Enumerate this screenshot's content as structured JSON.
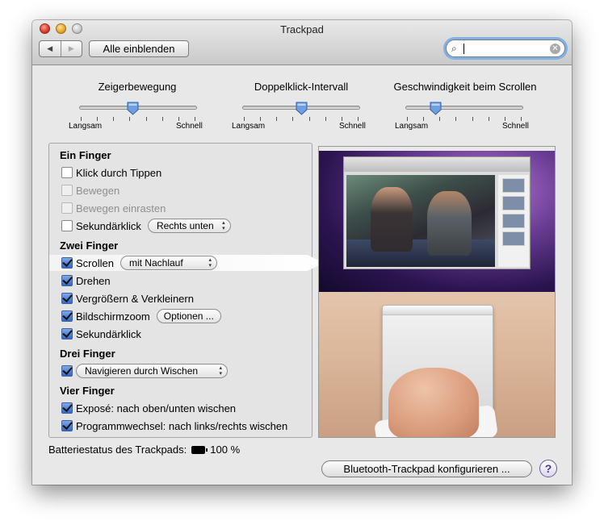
{
  "window": {
    "title": "Trackpad",
    "show_all_label": "Alle einblenden",
    "nav_back_icon": "◀",
    "nav_forward_icon": "▶",
    "search": {
      "value": "",
      "placeholder": ""
    }
  },
  "sliders": [
    {
      "label": "Zeigerbewegung",
      "min_label": "Langsam",
      "max_label": "Schnell",
      "value_fraction": 0.45
    },
    {
      "label": "Doppelklick-Intervall",
      "min_label": "Langsam",
      "max_label": "Schnell",
      "value_fraction": 0.5
    },
    {
      "label": "Geschwindigkeit beim Scrollen",
      "min_label": "Langsam",
      "max_label": "Schnell",
      "value_fraction": 0.25
    }
  ],
  "gestures": {
    "one_finger": {
      "heading": "Ein Finger",
      "tap_click": {
        "label": "Klick durch Tippen",
        "checked": false,
        "enabled": true
      },
      "drag": {
        "label": "Bewegen",
        "checked": false,
        "enabled": false
      },
      "drag_lock": {
        "label": "Bewegen einrasten",
        "checked": false,
        "enabled": false
      },
      "secondary_click": {
        "label": "Sekundärklick",
        "checked": false,
        "enabled": true,
        "option": "Rechts unten"
      }
    },
    "two_fingers": {
      "heading": "Zwei Finger",
      "scroll": {
        "label": "Scrollen",
        "checked": true,
        "option": "mit Nachlauf"
      },
      "rotate": {
        "label": "Drehen",
        "checked": true
      },
      "zoom": {
        "label": "Vergrößern & Verkleinern",
        "checked": true
      },
      "screen_zoom": {
        "label": "Bildschirmzoom",
        "checked": true,
        "button": "Optionen ..."
      },
      "secondary_click": {
        "label": "Sekundärklick",
        "checked": true
      }
    },
    "three_fingers": {
      "heading": "Drei Finger",
      "swipe": {
        "checked": true,
        "option": "Navigieren durch Wischen"
      }
    },
    "four_fingers": {
      "heading": "Vier Finger",
      "expose": {
        "label": "Exposé: nach oben/unten wischen",
        "checked": true
      },
      "app_switch": {
        "label": "Programmwechsel: nach links/rechts wischen",
        "checked": true
      }
    }
  },
  "battery": {
    "label": "Batteriestatus des Trackpads:",
    "value": "100 %"
  },
  "footer": {
    "configure_button": "Bluetooth-Trackpad konfigurieren ...",
    "help_label": "?"
  }
}
